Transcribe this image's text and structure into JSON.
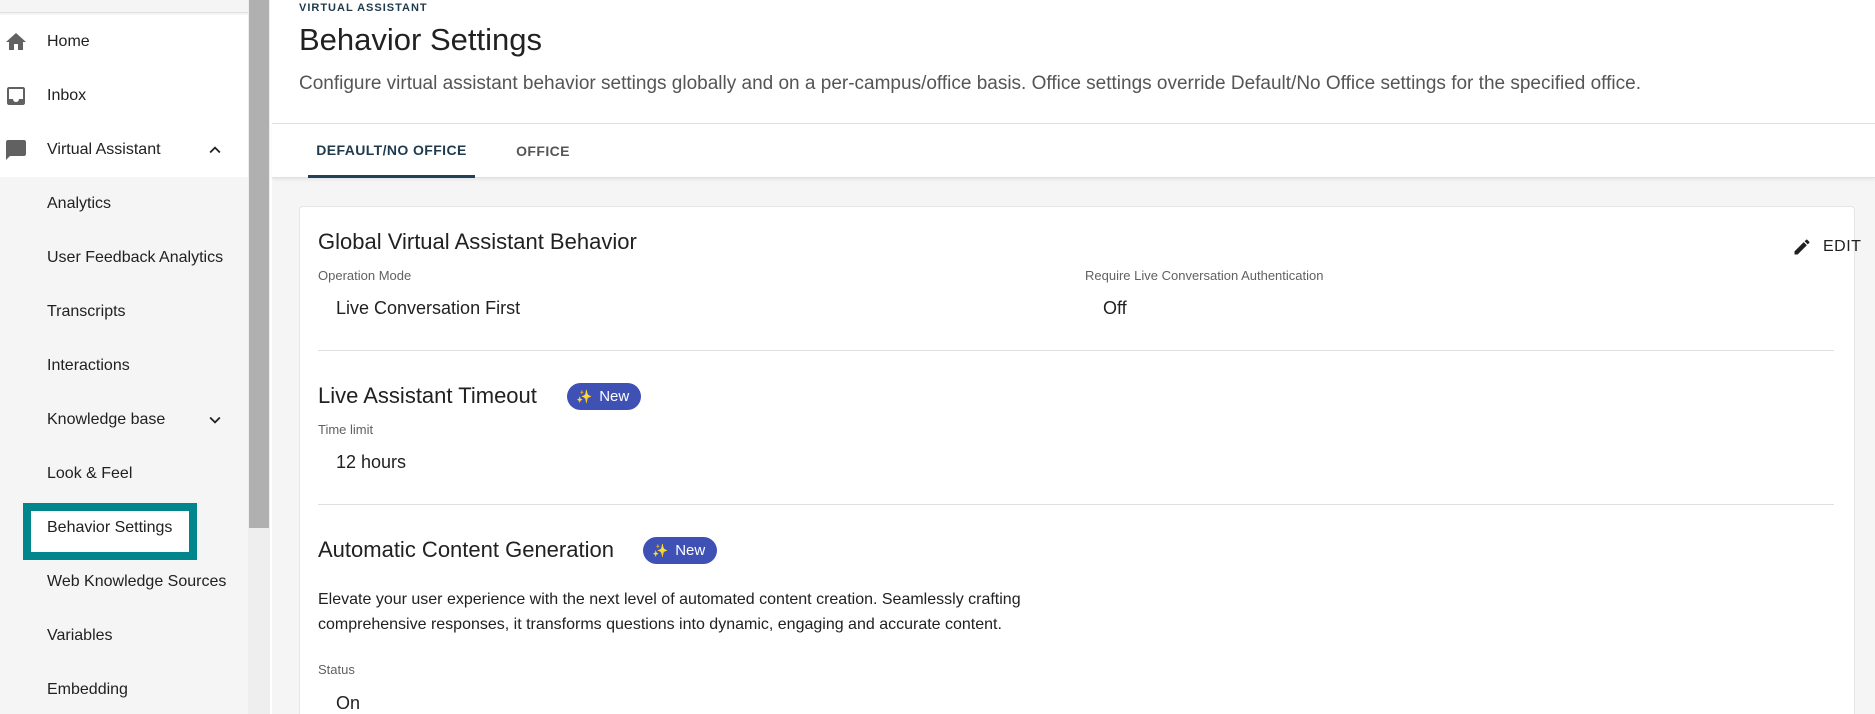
{
  "sidebar": {
    "top_items": [
      {
        "label": "Home",
        "icon": "home-icon"
      },
      {
        "label": "Inbox",
        "icon": "inbox-icon"
      },
      {
        "label": "Virtual Assistant",
        "icon": "chat-icon",
        "expanded": true
      }
    ],
    "sub_items": [
      {
        "label": "Analytics"
      },
      {
        "label": "User Feedback Analytics"
      },
      {
        "label": "Transcripts"
      },
      {
        "label": "Interactions"
      },
      {
        "label": "Knowledge base",
        "expandable": true
      },
      {
        "label": "Look & Feel"
      },
      {
        "label": "Behavior Settings",
        "active": true
      },
      {
        "label": "Web Knowledge Sources"
      },
      {
        "label": "Variables"
      },
      {
        "label": "Embedding"
      }
    ],
    "highlight_color": "#00868b"
  },
  "header": {
    "eyebrow": "VIRTUAL ASSISTANT",
    "title": "Behavior Settings",
    "description": "Configure virtual assistant behavior settings globally and on a per-campus/office basis. Office settings override Default/No Office settings for the specified office."
  },
  "tabs": [
    {
      "label": "DEFAULT/NO OFFICE",
      "active": true
    },
    {
      "label": "OFFICE",
      "active": false
    }
  ],
  "card": {
    "edit_label": "EDIT",
    "global": {
      "title": "Global Virtual Assistant Behavior",
      "operation_mode_label": "Operation Mode",
      "operation_mode_value": "Live Conversation First",
      "auth_label": "Require Live Conversation Authentication",
      "auth_value": "Off"
    },
    "timeout": {
      "title": "Live Assistant Timeout",
      "badge": "New",
      "time_limit_label": "Time limit",
      "time_limit_value": "12 hours"
    },
    "content_gen": {
      "title": "Automatic Content Generation",
      "badge": "New",
      "description_line1": "Elevate your user experience with the next level of automated content creation. Seamlessly crafting",
      "description_line2": "comprehensive responses, it transforms questions into dynamic, engaging and accurate content.",
      "status_label": "Status",
      "status_value": "On"
    }
  },
  "colors": {
    "badge": "#3f51b5",
    "tab_active": "#1f3a4d"
  }
}
